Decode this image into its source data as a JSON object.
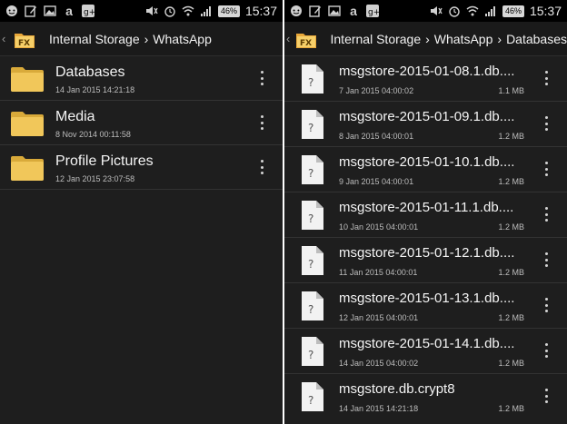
{
  "colors": {
    "background": "#1e1e1e",
    "statusbar": "#000000",
    "folder": "#f1c75a",
    "file": "#f2f2f2"
  },
  "left": {
    "status": {
      "time": "15:37",
      "battery": "46%"
    },
    "breadcrumb": [
      "Internal Storage",
      "WhatsApp"
    ],
    "items": [
      {
        "name": "Databases",
        "date": "14 Jan 2015 14:21:18",
        "icon": "folder-icon"
      },
      {
        "name": "Media",
        "date": "8 Nov 2014 00:11:58",
        "icon": "folder-icon"
      },
      {
        "name": "Profile Pictures",
        "date": "12 Jan 2015 23:07:58",
        "icon": "folder-icon"
      }
    ]
  },
  "right": {
    "status": {
      "time": "15:37",
      "battery": "46%"
    },
    "breadcrumb": [
      "Internal Storage",
      "WhatsApp",
      "Databases"
    ],
    "items": [
      {
        "name": "msgstore-2015-01-08.1.db....",
        "date": "7 Jan 2015 04:00:02",
        "size": "1.1 MB"
      },
      {
        "name": "msgstore-2015-01-09.1.db....",
        "date": "8 Jan 2015 04:00:01",
        "size": "1.2 MB"
      },
      {
        "name": "msgstore-2015-01-10.1.db....",
        "date": "9 Jan 2015 04:00:01",
        "size": "1.2 MB"
      },
      {
        "name": "msgstore-2015-01-11.1.db....",
        "date": "10 Jan 2015 04:00:01",
        "size": "1.2 MB"
      },
      {
        "name": "msgstore-2015-01-12.1.db....",
        "date": "11 Jan 2015 04:00:01",
        "size": "1.2 MB"
      },
      {
        "name": "msgstore-2015-01-13.1.db....",
        "date": "12 Jan 2015 04:00:01",
        "size": "1.2 MB"
      },
      {
        "name": "msgstore-2015-01-14.1.db....",
        "date": "14 Jan 2015 04:00:02",
        "size": "1.2 MB"
      },
      {
        "name": "msgstore.db.crypt8",
        "date": "14 Jan 2015 14:21:18",
        "size": "1.2 MB"
      }
    ]
  }
}
